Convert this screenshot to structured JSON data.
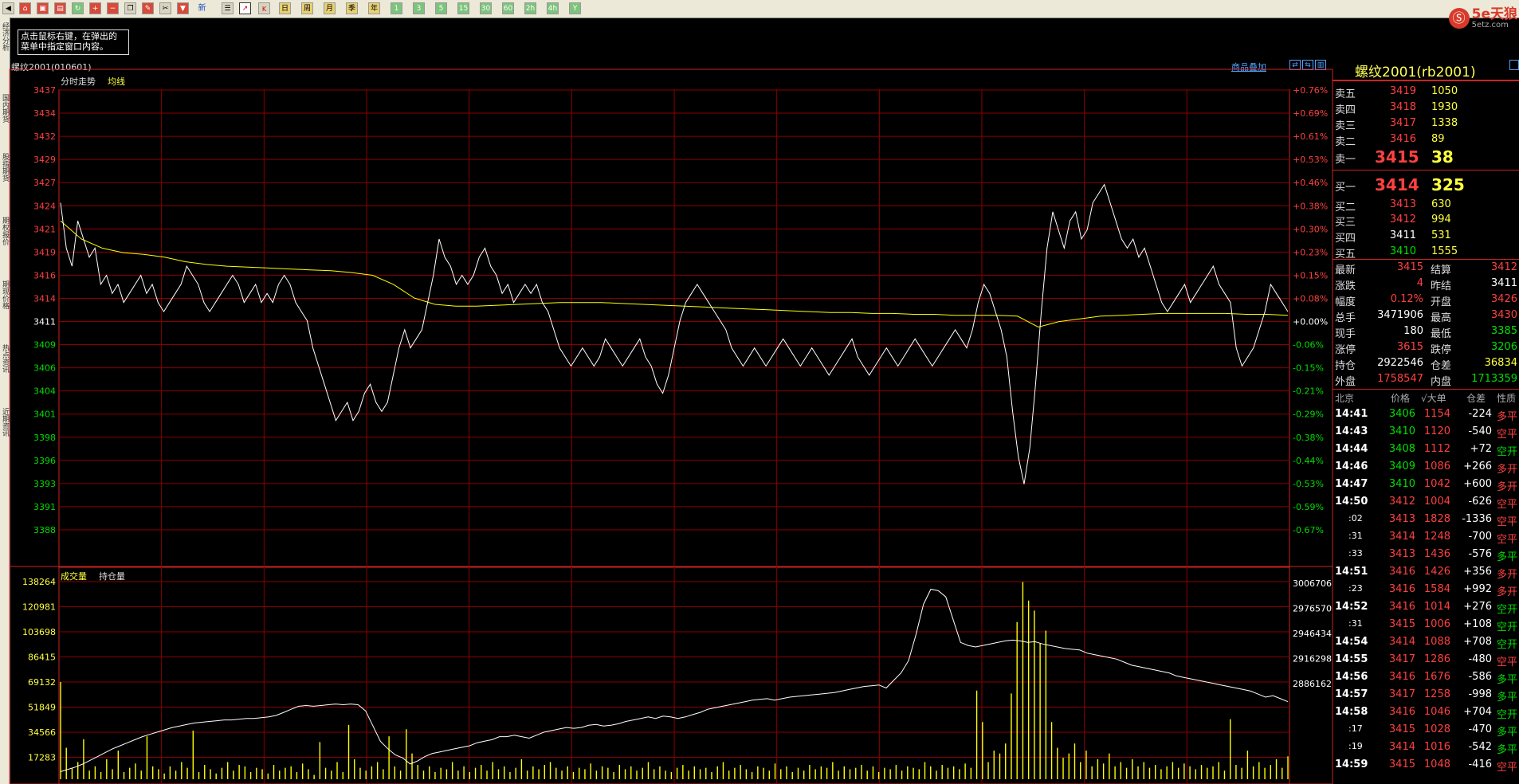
{
  "toolbar": {
    "period_buttons": [
      "日",
      "周",
      "月",
      "季",
      "年",
      "1",
      "3",
      "5",
      "15",
      "30",
      "60",
      "2h",
      "4h",
      "Y"
    ],
    "new_label": "新"
  },
  "logo": {
    "symbol": "Ⓢ",
    "brand": "5e天狼",
    "url": "5etz.com"
  },
  "side_tabs": [
    "经济分析",
    "国内期货",
    "股指期货",
    "期权报价",
    "期现价格",
    "热点资讯",
    "近期资讯"
  ],
  "tooltip": {
    "line1": "点击鼠标右键，在弹出的",
    "line2": "菜单中指定窗口内容。"
  },
  "chart": {
    "title": "螺纹2001(010601)",
    "overlay_link": "商品叠加",
    "panel1_label": "分时走势",
    "panel1_avg_label": "均线",
    "panel2_label": "成交量",
    "panel2_oi_label": "持仓量"
  },
  "chart_data": {
    "type": "line",
    "price_axis": [
      "3437",
      "3434",
      "3432",
      "3429",
      "3427",
      "3424",
      "3421",
      "3419",
      "3416",
      "3414",
      "3411",
      "3409",
      "3406",
      "3404",
      "3401",
      "3398",
      "3396",
      "3393",
      "3391",
      "3388"
    ],
    "pct_axis": [
      "+0.76%",
      "+0.69%",
      "+0.61%",
      "+0.53%",
      "+0.46%",
      "+0.38%",
      "+0.30%",
      "+0.23%",
      "+0.15%",
      "+0.08%",
      "+0.00%",
      "-0.06%",
      "-0.15%",
      "-0.21%",
      "-0.29%",
      "-0.38%",
      "-0.44%",
      "-0.53%",
      "-0.59%",
      "-0.67%"
    ],
    "vol_axis": [
      "138264",
      "120981",
      "103698",
      "86415",
      "69132",
      "51849",
      "34566",
      "17283"
    ],
    "oi_axis": [
      "3006706",
      "2976570",
      "2946434",
      "2916298",
      "2886162"
    ],
    "price_range": [
      3386.5,
      3437.5
    ],
    "prev_settle": 3411,
    "price_series": [
      3425,
      3420,
      3418,
      3423,
      3421,
      3419,
      3420,
      3416,
      3417,
      3415,
      3416,
      3414,
      3415,
      3416,
      3417,
      3415,
      3416,
      3414,
      3413,
      3414,
      3415,
      3416,
      3418,
      3417,
      3416,
      3414,
      3413,
      3414,
      3415,
      3416,
      3417,
      3416,
      3414,
      3415,
      3416,
      3414,
      3415,
      3414,
      3416,
      3417,
      3416,
      3414,
      3413,
      3412,
      3409,
      3407,
      3405,
      3403,
      3401,
      3402,
      3403,
      3401,
      3402,
      3404,
      3405,
      3403,
      3402,
      3403,
      3406,
      3409,
      3411,
      3409,
      3410,
      3411,
      3414,
      3417,
      3421,
      3419,
      3418,
      3416,
      3417,
      3416,
      3417,
      3419,
      3420,
      3418,
      3417,
      3415,
      3416,
      3414,
      3415,
      3416,
      3415,
      3416,
      3414,
      3413,
      3411,
      3409,
      3408,
      3407,
      3408,
      3409,
      3408,
      3407,
      3408,
      3410,
      3409,
      3408,
      3407,
      3408,
      3409,
      3410,
      3408,
      3407,
      3405,
      3404,
      3406,
      3409,
      3412,
      3414,
      3415,
      3416,
      3415,
      3414,
      3413,
      3412,
      3411,
      3409,
      3408,
      3407,
      3408,
      3409,
      3408,
      3407,
      3408,
      3409,
      3410,
      3409,
      3408,
      3407,
      3408,
      3409,
      3408,
      3407,
      3406,
      3407,
      3408,
      3409,
      3410,
      3408,
      3407,
      3406,
      3407,
      3408,
      3409,
      3408,
      3407,
      3408,
      3409,
      3410,
      3409,
      3408,
      3407,
      3408,
      3409,
      3410,
      3411,
      3410,
      3409,
      3411,
      3414,
      3416,
      3415,
      3413,
      3411,
      3408,
      3402,
      3397,
      3394,
      3398,
      3405,
      3413,
      3420,
      3424,
      3422,
      3420,
      3423,
      3424,
      3421,
      3422,
      3425,
      3426,
      3427,
      3425,
      3423,
      3421,
      3420,
      3421,
      3419,
      3420,
      3418,
      3416,
      3414,
      3413,
      3414,
      3415,
      3416,
      3414,
      3415,
      3416,
      3417,
      3418,
      3416,
      3415,
      3414,
      3409,
      3407,
      3408,
      3409,
      3411,
      3413,
      3416,
      3415,
      3414,
      3413
    ],
    "avg_series": [
      3423,
      3421,
      3420,
      3419.5,
      3419.3,
      3419,
      3418.5,
      3418.2,
      3418,
      3417.9,
      3417.8,
      3417.7,
      3417.6,
      3417.5,
      3417.3,
      3417,
      3416,
      3414.5,
      3413.8,
      3413.6,
      3413.6,
      3413.7,
      3413.8,
      3413.9,
      3414,
      3414,
      3414,
      3413.9,
      3413.8,
      3413.7,
      3413.6,
      3413.5,
      3413.4,
      3413.3,
      3413.2,
      3413.1,
      3413,
      3412.9,
      3412.9,
      3412.8,
      3412.8,
      3412.7,
      3412.7,
      3412.6,
      3412.6,
      3412.6,
      3412.5,
      3411.3,
      3411.9,
      3412.2,
      3412.5,
      3412.6,
      3412.7,
      3412.8,
      3412.8,
      3412.8,
      3412.8,
      3412.7,
      3412.7,
      3412.6
    ],
    "vol_range": [
      0,
      138264
    ],
    "oi_range": [
      2880000,
      3010000
    ],
    "volume_series": [
      68000,
      22000,
      8000,
      12000,
      28000,
      6000,
      9000,
      5000,
      14000,
      7000,
      20000,
      5000,
      8000,
      11000,
      6000,
      30000,
      9000,
      7000,
      4000,
      9000,
      6000,
      12000,
      8000,
      34000,
      5000,
      10000,
      7000,
      4000,
      8000,
      12000,
      6000,
      10000,
      9000,
      5000,
      8000,
      7000,
      4000,
      10000,
      6000,
      8000,
      9000,
      5000,
      11000,
      7000,
      3000,
      26000,
      8000,
      6000,
      12000,
      5000,
      38000,
      14000,
      8000,
      6000,
      9000,
      12000,
      7000,
      30000,
      9000,
      6000,
      35000,
      18000,
      10000,
      6000,
      9000,
      5000,
      8000,
      7000,
      12000,
      6000,
      9000,
      5000,
      8000,
      10000,
      6000,
      12000,
      7000,
      9000,
      5000,
      8000,
      14000,
      6000,
      9000,
      7000,
      10000,
      12000,
      8000,
      6000,
      9000,
      5000,
      8000,
      7000,
      11000,
      6000,
      9000,
      8000,
      5000,
      10000,
      7000,
      9000,
      6000,
      8000,
      12000,
      7000,
      9000,
      6000,
      5000,
      8000,
      10000,
      6000,
      9000,
      7000,
      8000,
      5000,
      9000,
      12000,
      6000,
      8000,
      10000,
      7000,
      5000,
      9000,
      8000,
      6000,
      11000,
      7000,
      9000,
      5000,
      8000,
      6000,
      10000,
      7000,
      9000,
      8000,
      12000,
      6000,
      9000,
      7000,
      8000,
      10000,
      6000,
      9000,
      5000,
      8000,
      7000,
      10000,
      6000,
      9000,
      8000,
      7000,
      12000,
      9000,
      6000,
      10000,
      8000,
      9000,
      7000,
      11000,
      8000,
      62000,
      40000,
      12000,
      20000,
      18000,
      25000,
      60000,
      110000,
      138000,
      125000,
      118000,
      95000,
      104000,
      40000,
      22000,
      15000,
      18000,
      25000,
      12000,
      20000,
      9000,
      14000,
      11000,
      18000,
      9000,
      12000,
      8000,
      14000,
      9000,
      12000,
      8000,
      10000,
      7000,
      9000,
      12000,
      8000,
      11000,
      9000,
      7000,
      10000,
      8000,
      9000,
      12000,
      6000,
      42000,
      10000,
      8000,
      20000,
      9000,
      12000,
      8000,
      10000,
      14000,
      8000,
      16000
    ],
    "oi_series": [
      2885000,
      2886500,
      2888000,
      2890000,
      2892500,
      2895000,
      2897500,
      2900000,
      2902000,
      2904000,
      2906000,
      2908000,
      2909500,
      2911000,
      2912500,
      2914000,
      2915000,
      2916000,
      2917000,
      2917500,
      2918000,
      2918500,
      2919000,
      2919000,
      2919500,
      2920000,
      2920000,
      2920500,
      2921000,
      2922000,
      2924000,
      2926000,
      2928000,
      2928500,
      2928000,
      2928500,
      2929000,
      2929500,
      2929000,
      2929500,
      2929000,
      2925000,
      2915000,
      2905000,
      2900000,
      2896000,
      2894000,
      2890000,
      2892000,
      2895000,
      2897000,
      2898000,
      2899000,
      2900000,
      2901000,
      2902000,
      2904000,
      2905000,
      2906000,
      2908000,
      2908000,
      2909000,
      2908000,
      2907000,
      2909000,
      2911000,
      2912000,
      2913000,
      2914000,
      2913500,
      2914000,
      2915500,
      2916000,
      2915000,
      2915500,
      2916500,
      2918000,
      2919000,
      2920000,
      2921000,
      2920000,
      2921500,
      2921000,
      2920000,
      2921000,
      2922500,
      2924000,
      2926000,
      2927000,
      2928000,
      2929000,
      2930000,
      2931000,
      2932000,
      2932500,
      2933000,
      2932000,
      2933000,
      2934000,
      2934500,
      2935000,
      2935500,
      2936000,
      2936500,
      2937000,
      2938000,
      2939000,
      2940000,
      2941000,
      2941500,
      2942000,
      2940000,
      2945000,
      2950000,
      2958000,
      2975000,
      2995000,
      3005000,
      3004000,
      3000000,
      2985000,
      2970000,
      2968000,
      2967000,
      2968000,
      2969000,
      2970000,
      2971000,
      2971500,
      2971000,
      2970000,
      2970500,
      2969000,
      2968000,
      2967000,
      2966000,
      2965500,
      2965000,
      2963000,
      2962000,
      2961000,
      2960000,
      2959000,
      2957000,
      2955000,
      2954000,
      2953000,
      2952000,
      2951000,
      2950000,
      2948000,
      2947000,
      2946000,
      2945000,
      2944000,
      2943000,
      2942000,
      2941000,
      2940000,
      2939000,
      2938000,
      2936000,
      2934000,
      2935000,
      2933000,
      2931000
    ]
  },
  "quote": {
    "title": "螺纹2001(rb2001)",
    "asks": [
      {
        "label": "卖五",
        "price": "3419",
        "vol": "1050"
      },
      {
        "label": "卖四",
        "price": "3418",
        "vol": "1930"
      },
      {
        "label": "卖三",
        "price": "3417",
        "vol": "1338"
      },
      {
        "label": "卖二",
        "price": "3416",
        "vol": "89"
      },
      {
        "label": "卖一",
        "price": "3415",
        "vol": "38"
      }
    ],
    "bids": [
      {
        "label": "买一",
        "price": "3414",
        "vol": "325"
      },
      {
        "label": "买二",
        "price": "3413",
        "vol": "630"
      },
      {
        "label": "买三",
        "price": "3412",
        "vol": "994"
      },
      {
        "label": "买四",
        "price": "3411",
        "vol": "531"
      },
      {
        "label": "买五",
        "price": "3410",
        "vol": "1555"
      }
    ],
    "stats": [
      {
        "l1": "最新",
        "v1": "3415",
        "c1": "red",
        "l2": "结算",
        "v2": "3412",
        "c2": "red"
      },
      {
        "l1": "涨跌",
        "v1": "4",
        "c1": "red",
        "l2": "昨结",
        "v2": "3411",
        "c2": "white"
      },
      {
        "l1": "幅度",
        "v1": "0.12%",
        "c1": "red",
        "l2": "开盘",
        "v2": "3426",
        "c2": "red"
      },
      {
        "l1": "总手",
        "v1": "3471906",
        "c1": "white",
        "l2": "最高",
        "v2": "3430",
        "c2": "red"
      },
      {
        "l1": "现手",
        "v1": "180",
        "c1": "white",
        "l2": "最低",
        "v2": "3385",
        "c2": "green"
      },
      {
        "l1": "涨停",
        "v1": "3615",
        "c1": "red",
        "l2": "跌停",
        "v2": "3206",
        "c2": "green"
      },
      {
        "l1": "持仓",
        "v1": "2922546",
        "c1": "white",
        "l2": "仓差",
        "v2": "36834",
        "c2": "yellow"
      },
      {
        "l1": "外盘",
        "v1": "1758547",
        "c1": "red",
        "l2": "内盘",
        "v2": "1713359",
        "c2": "green"
      }
    ],
    "tick_headers": [
      "北京",
      "价格",
      "√大单",
      "仓差",
      "性质"
    ],
    "ticks": [
      {
        "time": "14:41",
        "price": "3406",
        "pc": "green",
        "vol": "1154",
        "diff": "-224",
        "nature": "多平",
        "nc": "red"
      },
      {
        "time": "14:43",
        "price": "3410",
        "pc": "green",
        "vol": "1120",
        "diff": "-540",
        "nature": "空平",
        "nc": "red"
      },
      {
        "time": "14:44",
        "price": "3408",
        "pc": "green",
        "vol": "1112",
        "diff": "+72",
        "nature": "空开",
        "nc": "green"
      },
      {
        "time": "14:46",
        "price": "3409",
        "pc": "green",
        "vol": "1086",
        "diff": "+266",
        "nature": "多开",
        "nc": "red"
      },
      {
        "time": "14:47",
        "price": "3410",
        "pc": "green",
        "vol": "1042",
        "diff": "+600",
        "nature": "多开",
        "nc": "red"
      },
      {
        "time": "14:50",
        "price": "3412",
        "pc": "red",
        "vol": "1004",
        "diff": "-626",
        "nature": "空平",
        "nc": "red"
      },
      {
        "time": ":02",
        "price": "3413",
        "pc": "red",
        "vol": "1828",
        "diff": "-1336",
        "nature": "空平",
        "nc": "red"
      },
      {
        "time": ":31",
        "price": "3414",
        "pc": "red",
        "vol": "1248",
        "diff": "-700",
        "nature": "空平",
        "nc": "red"
      },
      {
        "time": ":33",
        "price": "3413",
        "pc": "red",
        "vol": "1436",
        "diff": "-576",
        "nature": "多平",
        "nc": "green"
      },
      {
        "time": "14:51",
        "price": "3416",
        "pc": "red",
        "vol": "1426",
        "diff": "+356",
        "nature": "多开",
        "nc": "red"
      },
      {
        "time": ":23",
        "price": "3416",
        "pc": "red",
        "vol": "1584",
        "diff": "+992",
        "nature": "多开",
        "nc": "red"
      },
      {
        "time": "14:52",
        "price": "3416",
        "pc": "red",
        "vol": "1014",
        "diff": "+276",
        "nature": "空开",
        "nc": "green"
      },
      {
        "time": ":31",
        "price": "3415",
        "pc": "red",
        "vol": "1006",
        "diff": "+108",
        "nature": "空开",
        "nc": "green"
      },
      {
        "time": "14:54",
        "price": "3414",
        "pc": "red",
        "vol": "1088",
        "diff": "+708",
        "nature": "空开",
        "nc": "green"
      },
      {
        "time": "14:55",
        "price": "3417",
        "pc": "red",
        "vol": "1286",
        "diff": "-480",
        "nature": "空平",
        "nc": "red"
      },
      {
        "time": "14:56",
        "price": "3416",
        "pc": "red",
        "vol": "1676",
        "diff": "-586",
        "nature": "多平",
        "nc": "green"
      },
      {
        "time": "14:57",
        "price": "3417",
        "pc": "red",
        "vol": "1258",
        "diff": "-998",
        "nature": "多平",
        "nc": "green"
      },
      {
        "time": "14:58",
        "price": "3416",
        "pc": "red",
        "vol": "1046",
        "diff": "+704",
        "nature": "空开",
        "nc": "green"
      },
      {
        "time": ":17",
        "price": "3415",
        "pc": "red",
        "vol": "1028",
        "diff": "-470",
        "nature": "多平",
        "nc": "green"
      },
      {
        "time": ":19",
        "price": "3414",
        "pc": "red",
        "vol": "1016",
        "diff": "-542",
        "nature": "多平",
        "nc": "green"
      },
      {
        "time": "14:59",
        "price": "3415",
        "pc": "red",
        "vol": "1048",
        "diff": "-416",
        "nature": "空平",
        "nc": "red"
      }
    ]
  },
  "colors": {
    "grid": "#8b0000",
    "price_line": "#ffffff",
    "avg_line": "#ffff00",
    "volume": "#ffff00",
    "red": "#ff4040",
    "green": "#00dd00",
    "yellow": "#ffff40"
  }
}
